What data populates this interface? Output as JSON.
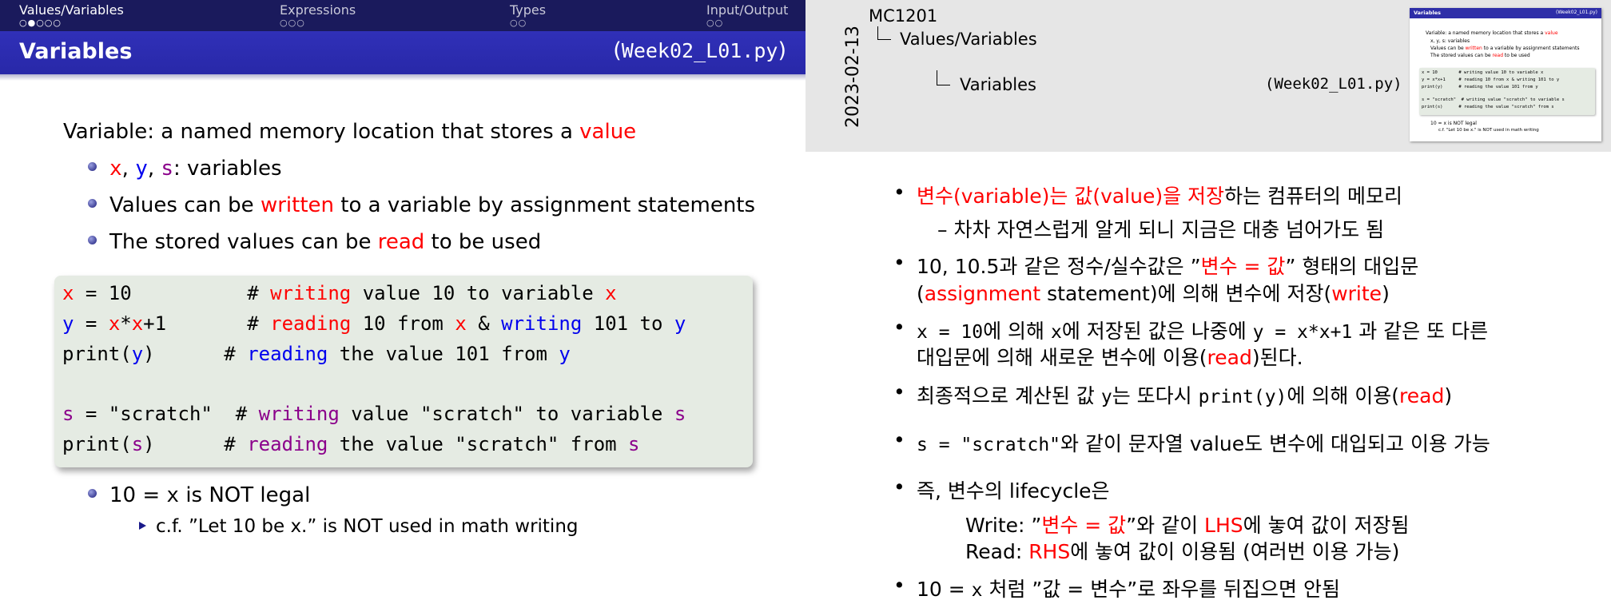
{
  "slide": {
    "nav": {
      "sections": [
        {
          "label": "Values/Variables",
          "dots": "○●○○○"
        },
        {
          "label": "Expressions",
          "dots": "○○○"
        },
        {
          "label": "Types",
          "dots": "○○"
        },
        {
          "label": "Input/Output",
          "dots": "○○"
        }
      ]
    },
    "title": "Variables",
    "file": {
      "open": "(",
      "name": "Week02_L01.py",
      "close": ")"
    },
    "definition": {
      "prefix": "Variable: a named memory location that stores a ",
      "highlight": "value"
    },
    "bullets": {
      "b1": {
        "x": "x",
        "sep1": ", ",
        "y": "y",
        "sep2": ", ",
        "s": "s",
        "rest": ": variables"
      },
      "b2": {
        "pre": "Values can be ",
        "hl": "written",
        "post": " to a variable by assignment statements"
      },
      "b3": {
        "pre": "The stored values can be ",
        "hl": "read",
        "post": " to be used"
      }
    },
    "code": {
      "l1": {
        "var": "x",
        "mid": " = 10          # ",
        "kw": "writing",
        "post": " value 10 to variable ",
        "tail": "x"
      },
      "l2": {
        "var": "y",
        "eq": " = ",
        "x1": "x",
        "op": "*",
        "x2": "x",
        "plus": "+1       # ",
        "kw1": "reading",
        "mid1": " 10 from ",
        "x3": "x",
        "amp": " & ",
        "kw2": "writing",
        "mid2": " 101 to ",
        "tail": "y"
      },
      "l3": {
        "pre": "print(",
        "var": "y",
        "post": ")      # ",
        "kw": "reading",
        "rest": " the value 101 from ",
        "tail": "y"
      },
      "l4": {
        "var": "s",
        "mid": " = \"scratch\"  # ",
        "kw": "writing",
        "post": " value \"scratch\" to variable ",
        "tail": "s"
      },
      "l5": {
        "pre": "print(",
        "var": "s",
        "post": ")      # ",
        "kw": "reading",
        "rest": " the value \"scratch\" from ",
        "tail": "s"
      }
    },
    "illegal": {
      "pre": "10 = ",
      "x": "x",
      "post": "  is NOT legal"
    },
    "note": "c.f. ”Let 10 be x.” is NOT used in math writing"
  },
  "notes": {
    "date": "2023-02-13",
    "course": "MC1201",
    "section": "Values/Variables",
    "subsection": "Variables",
    "file": "(Week02_L01.py)",
    "thumb": {
      "section": "Variables",
      "file": "(Week02_L01.py)",
      "def_prefix": "Variable: a named memory location that stores a ",
      "def_hl": "value",
      "b1": "x, y, s: variables",
      "b2_pre": "Values can be ",
      "b2_hl": "written",
      "b2_post": " to a variable by assignment statements",
      "b3_pre": "The stored values can be ",
      "b3_hl": "read",
      "b3_post": " to be used",
      "c1": "x = 10        # writing value 10 to variable x",
      "c2": "y = x*x+1     # reading 10 from x & writing 101 to y",
      "c3": "print(y)      # reading the value 101 from y",
      "c4": "s = \"scratch\"  # writing value \"scratch\" to variable s",
      "c5": "print(s)      # reading the value \"scratch\" from s",
      "i1": "10 = x is NOT legal",
      "i2": "c.f. \"Let 10 be x.\" is NOT used in math writing"
    },
    "items": {
      "n1": {
        "hl1": "변수(variable)는 ",
        "hl2": "값(value)을 저장",
        "post": "하는 컴퓨터의 메모리"
      },
      "n1sub": "–  차차 자연스럽게 알게 되니 지금은 대충 넘어가도 됨",
      "n2": {
        "pre": "10, 10.5과 같은 정수/실수값은 ”",
        "hl": "변수 = 값",
        "post": "” 형태의 대입문"
      },
      "n2b": {
        "open": "(",
        "hl": "assignment",
        "mid": " statement)에 의해 변수에 저장(",
        "hl2": "write",
        "close": ")"
      },
      "n3": {
        "code1": "x = 10",
        "mid1": "에 의해 ",
        "code2": "x",
        "mid2": "에 저장된 값은 나중에 ",
        "code3": "y = x*x+1",
        "post": " 과 같은 또 다른"
      },
      "n3b": {
        "pre": "대입문에 의해 새로운 변수에 이용(",
        "hl": "read",
        "post": ")된다."
      },
      "n4": {
        "pre": "최종적으로 계산된 값 ",
        "code1": "y",
        "mid": "는 또다시 ",
        "code2": "print(y)",
        "mid2": "에 의해 이용(",
        "hl": "read",
        "post": ")"
      },
      "n5": {
        "code": "s = \"scratch\"",
        "post": "와 같이 문자열 value도 변수에 대입되고 이용 가능"
      },
      "n6": "즉, 변수의 lifecycle은",
      "n6w": {
        "pre": "Write: ”",
        "hl": "변수 = 값",
        "mid": "”와 같이 ",
        "hl2": "LHS",
        "post": "에 놓여 값이 저장됨"
      },
      "n6r": {
        "pre": "Read:  ",
        "hl": "RHS",
        "post": "에 놓여 값이 이용됨 (여러번 이용 가능)"
      },
      "n7": {
        "pre": "10 = ",
        "code": "x",
        "post": " 처럼 ”값 = 변수”로 좌우를 뒤집으면 안됨"
      }
    }
  },
  "colors": {
    "nav": "#1a1a5c",
    "title": "#2e2eb0",
    "red": "#ff0000",
    "blue": "#0000ee",
    "purple": "#8b008b",
    "code_bg": "#e5ebe3"
  }
}
